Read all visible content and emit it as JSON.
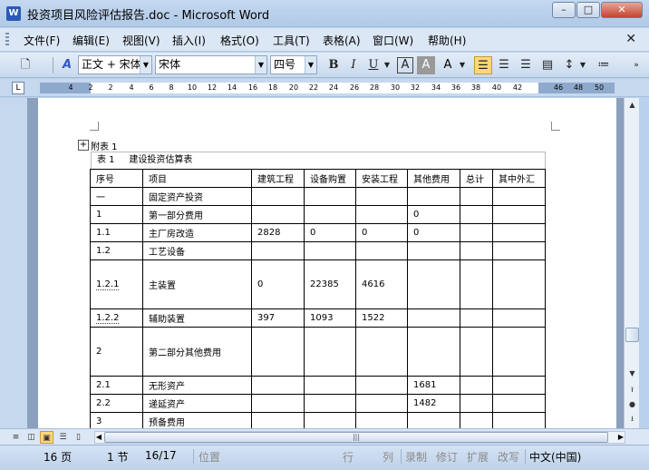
{
  "window": {
    "app_icon": "W",
    "title": "投资项目风险评估报告.doc - Microsoft Word",
    "minimize": "–",
    "maximize": "□",
    "close": "✕"
  },
  "menu": {
    "items": [
      "文件(F)",
      "编辑(E)",
      "视图(V)",
      "插入(I)",
      "格式(O)",
      "工具(T)",
      "表格(A)",
      "窗口(W)",
      "帮助(H)"
    ],
    "doc_close": "✕"
  },
  "toolbar": {
    "style_value": "正文 + 宋体",
    "font_value": "宋体",
    "size_value": "四号",
    "bold": "B",
    "italic": "I",
    "underline": "U",
    "char_border": "A",
    "char_shading": "A",
    "highlight": "A",
    "new_doc": "🗋",
    "styles_icon": "A"
  },
  "ruler": {
    "tab_selector": "L",
    "numbers": [
      "4",
      "2",
      "2",
      "4",
      "6",
      "8",
      "10",
      "12",
      "14",
      "16",
      "18",
      "20",
      "22",
      "24",
      "26",
      "28",
      "30",
      "32",
      "34",
      "36",
      "38",
      "40",
      "42",
      "46",
      "48",
      "50"
    ]
  },
  "document": {
    "appendix_label": "附表 1",
    "caption": "表 1     建设投资估算表",
    "move_handle": "+",
    "headers": [
      "序号",
      "项目",
      "建筑工程",
      "设备购置",
      "安装工程",
      "其他费用",
      "总计",
      "其中外汇"
    ],
    "rows": [
      [
        "一",
        "固定资产投资",
        "",
        "",
        "",
        "",
        "",
        ""
      ],
      [
        "1",
        "第一部分费用",
        "",
        "",
        "",
        "0",
        "",
        ""
      ],
      [
        "1.1",
        "主厂房改造",
        "2828",
        "0",
        "0",
        "0",
        "",
        ""
      ],
      [
        "1.2",
        "工艺设备",
        "",
        "",
        "",
        "",
        "",
        ""
      ],
      [
        "1.2.1",
        "主装置",
        "0",
        "22385",
        "4616",
        "",
        "",
        ""
      ],
      [
        "1.2.2",
        "辅助装置",
        "397",
        "1093",
        "1522",
        "",
        "",
        ""
      ],
      [
        "2",
        "第二部分其他费用",
        "",
        "",
        "",
        "",
        "",
        ""
      ],
      [
        "2.1",
        "无形资产",
        "",
        "",
        "",
        "1681",
        "",
        ""
      ],
      [
        "2.2",
        "递延资产",
        "",
        "",
        "",
        "1482",
        "",
        ""
      ],
      [
        "3",
        "预备费用",
        "",
        "",
        "",
        "",
        "",
        ""
      ]
    ]
  },
  "scroll": {
    "up": "▲",
    "down": "▼",
    "prev_page": "⭱",
    "select_browse": "●",
    "next_page": "⭳",
    "left": "◀",
    "right": "▶",
    "grip": "|||"
  },
  "status": {
    "page": "16 页",
    "section": "1 节",
    "page_of": "16/17",
    "position": "位置",
    "line": "行",
    "column": "列",
    "record": "录制",
    "revision": "修订",
    "extend": "扩展",
    "overtype": "改写",
    "language": "中文(中国)"
  },
  "colors": {
    "title_bar": "#b1c9e6",
    "active_button": "#ffd779",
    "workspace": "#8aa0bc"
  }
}
